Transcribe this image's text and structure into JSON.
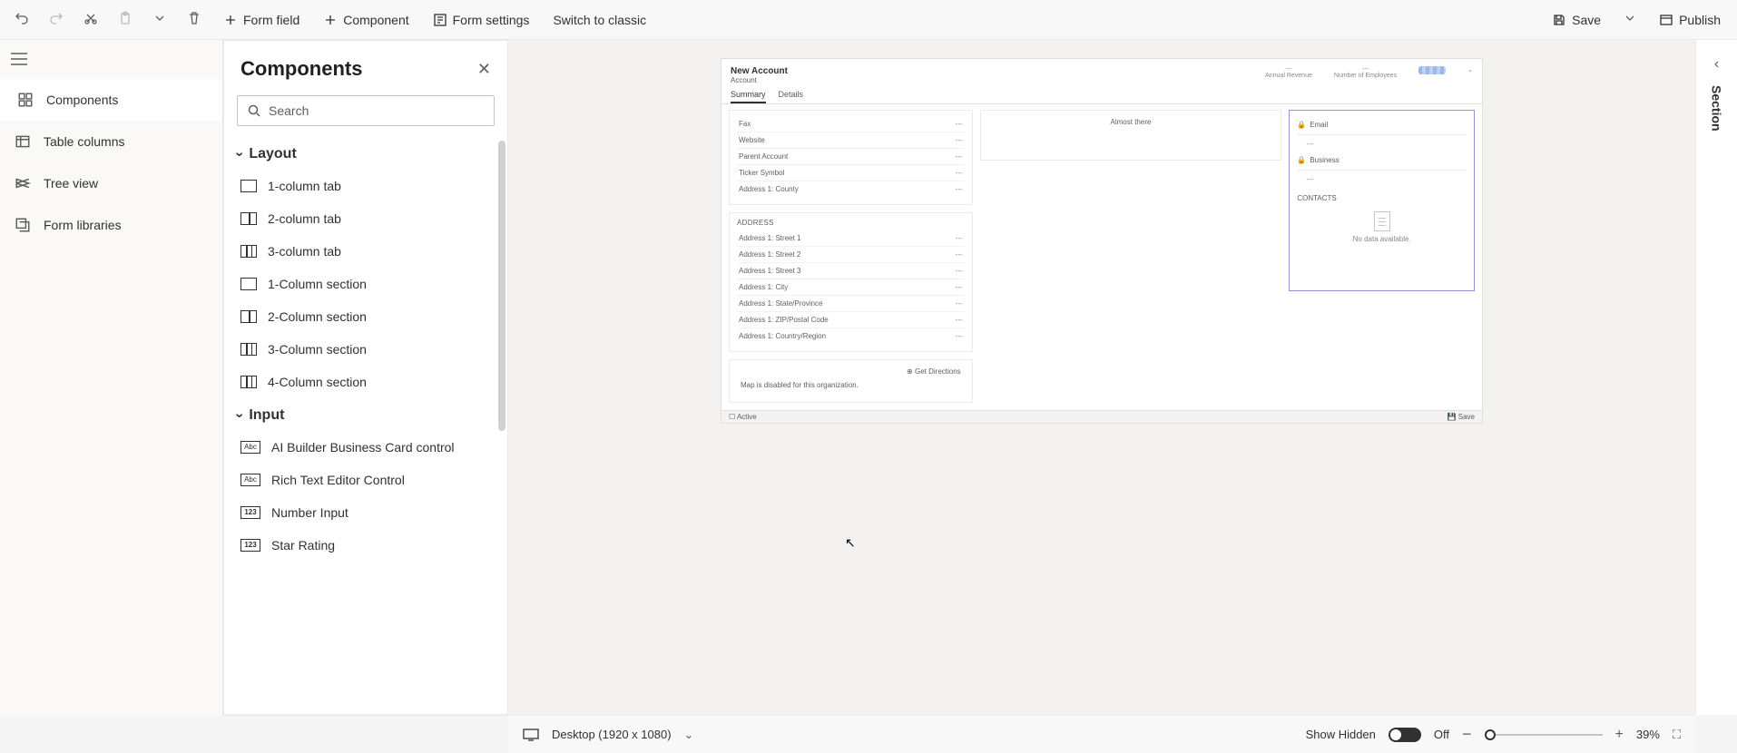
{
  "toolbar": {
    "form_field": "Form field",
    "component": "Component",
    "form_settings": "Form settings",
    "switch_classic": "Switch to classic",
    "save": "Save",
    "publish": "Publish"
  },
  "leftnav": {
    "items": [
      {
        "label": "Components"
      },
      {
        "label": "Table columns"
      },
      {
        "label": "Tree view"
      },
      {
        "label": "Form libraries"
      }
    ]
  },
  "panel": {
    "title": "Components",
    "search_placeholder": "Search",
    "groups": {
      "layout": {
        "title": "Layout",
        "items": [
          "1-column tab",
          "2-column tab",
          "3-column tab",
          "1-Column section",
          "2-Column section",
          "3-Column section",
          "4-Column section"
        ]
      },
      "input": {
        "title": "Input",
        "items": [
          "AI Builder Business Card control",
          "Rich Text Editor Control",
          "Number Input",
          "Star Rating"
        ]
      }
    }
  },
  "form": {
    "title": "New Account",
    "entity": "Account",
    "header_fields": [
      "Annual Revenue",
      "Number of Employees"
    ],
    "tabs": [
      "Summary",
      "Details"
    ],
    "fields_top": [
      {
        "label": "Fax",
        "value": "---"
      },
      {
        "label": "Website",
        "value": "---"
      },
      {
        "label": "Parent Account",
        "value": "---"
      },
      {
        "label": "Ticker Symbol",
        "value": "---"
      },
      {
        "label": "Address 1: County",
        "value": "---"
      }
    ],
    "address_section": "ADDRESS",
    "address_fields": [
      {
        "label": "Address 1: Street 1",
        "value": "---"
      },
      {
        "label": "Address 1: Street 2",
        "value": "---"
      },
      {
        "label": "Address 1: Street 3",
        "value": "---"
      },
      {
        "label": "Address 1: City",
        "value": "---"
      },
      {
        "label": "Address 1: State/Province",
        "value": "---"
      },
      {
        "label": "Address 1: ZIP/Postal Code",
        "value": "---"
      },
      {
        "label": "Address 1: Country/Region",
        "value": "---"
      }
    ],
    "get_directions": "Get Directions",
    "map_disabled": "Map is disabled for this organization.",
    "timeline_msg": "Almost there",
    "side": {
      "email": "Email",
      "business": "Business",
      "contacts_title": "CONTACTS",
      "no_data": "No data available."
    },
    "footer": {
      "status": "Active",
      "save": "Save"
    }
  },
  "rightpanel": {
    "label": "Section"
  },
  "bottombar": {
    "device": "Desktop (1920 x 1080)",
    "show_hidden": "Show Hidden",
    "toggle_state": "Off",
    "zoom": "39%"
  }
}
